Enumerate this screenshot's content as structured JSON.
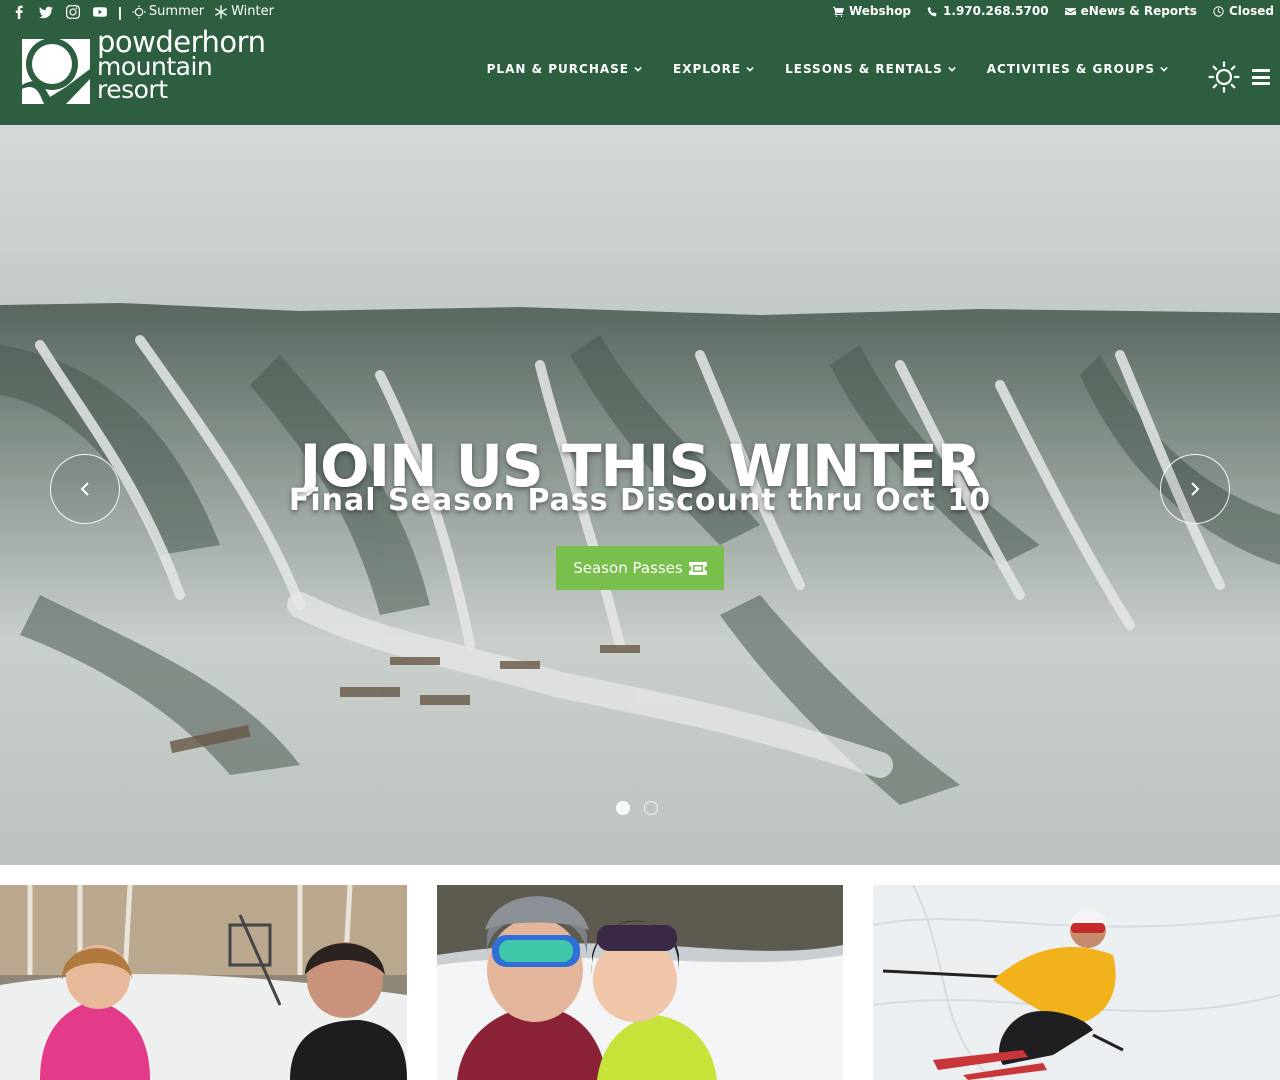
{
  "topbar": {
    "social_icons": [
      "facebook-icon",
      "twitter-icon",
      "instagram-icon",
      "youtube-icon"
    ],
    "separator": "|",
    "seasons": [
      {
        "label": "Summer",
        "icon": "sun-icon"
      },
      {
        "label": "Winter",
        "icon": "snowflake-icon"
      }
    ],
    "links": [
      {
        "label": "Webshop",
        "icon": "cart-icon"
      },
      {
        "label": "1.970.268.5700",
        "icon": "phone-icon"
      },
      {
        "label": "eNews & Reports",
        "icon": "envelope-icon"
      },
      {
        "label": "Closed",
        "icon": "clock-icon"
      }
    ]
  },
  "logo": {
    "line1": "powderhorn",
    "line2": "mountain",
    "line3": "resort"
  },
  "nav": {
    "items": [
      {
        "label": "PLAN & PURCHASE"
      },
      {
        "label": "EXPLORE"
      },
      {
        "label": "LESSONS & RENTALS"
      },
      {
        "label": "ACTIVITIES & GROUPS"
      }
    ],
    "weather_icon": "sun-icon",
    "menu_icon": "hamburger-icon"
  },
  "hero": {
    "title": "JOIN US THIS WINTER",
    "subtitle": "Final Season Pass Discount thru Oct 10",
    "cta_label": "Season Passes",
    "cta_icon": "ticket-icon",
    "slide_count": 2,
    "active_slide": 1
  },
  "tiles": [
    {
      "image": "couple-at-ski-lodge-photo"
    },
    {
      "image": "parent-and-child-in-ski-helmets-photo"
    },
    {
      "image": "skier-in-yellow-jacket-photo"
    }
  ],
  "colors": {
    "header_bg": "#2d5e3f",
    "cta_bg": "#79bf4c",
    "text_light": "#ffffff"
  }
}
